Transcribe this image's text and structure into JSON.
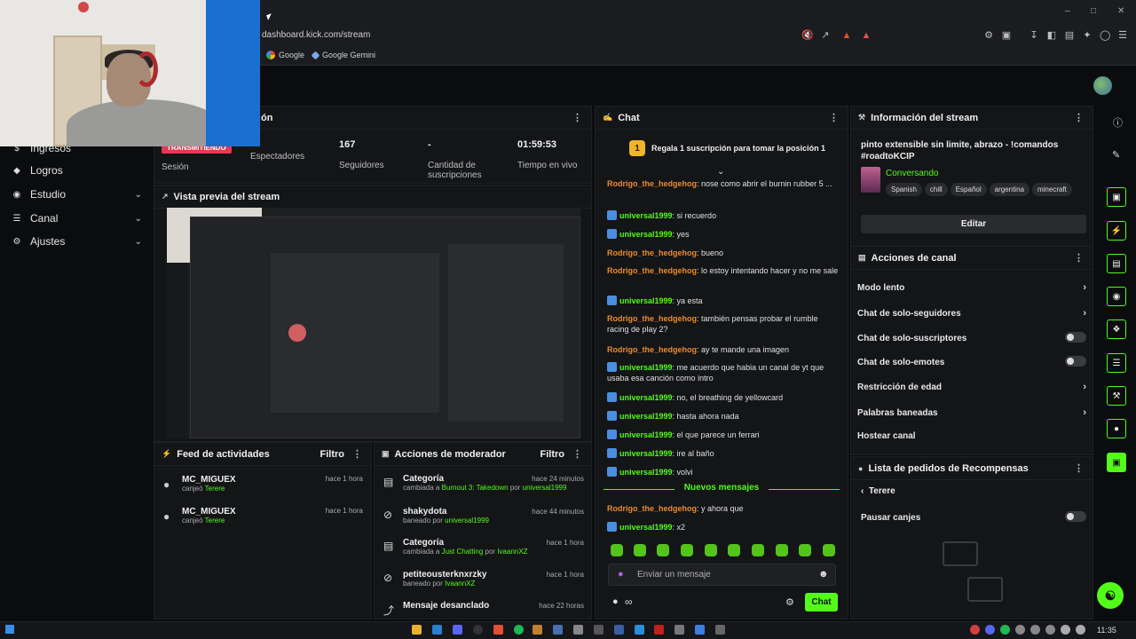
{
  "browser": {
    "url": "dashboard.kick.com/stream",
    "bookmarks": [
      "Google",
      "Google Gemini"
    ]
  },
  "sidebar": {
    "items": [
      {
        "label": "Ingresos",
        "icon": "dollar-icon",
        "chevron": false
      },
      {
        "label": "Logros",
        "icon": "trophy-icon",
        "chevron": false
      },
      {
        "label": "Estudio",
        "icon": "studio-icon",
        "chevron": true
      },
      {
        "label": "Canal",
        "icon": "channel-icon",
        "chevron": true
      },
      {
        "label": "Ajustes",
        "icon": "gear-icon",
        "chevron": true
      }
    ]
  },
  "session": {
    "title_fragment": "ón",
    "live_badge": "TRANSMITIENDO",
    "stats": [
      {
        "value": "",
        "label": "Sesión"
      },
      {
        "value": "",
        "label": "Espectadores"
      },
      {
        "value": "167",
        "label": "Seguidores"
      },
      {
        "value": "-",
        "label": "Cantidad de suscripciones"
      },
      {
        "value": "01:59:53",
        "label": "Tiempo en vivo"
      }
    ]
  },
  "preview": {
    "title": "Vista previa del stream"
  },
  "activity_feed": {
    "title": "Feed de actividades",
    "filter": "Filtro",
    "items": [
      {
        "user": "MC_MIGUEX",
        "action": "canjeó",
        "reward": "Terere",
        "time": "hace 1 hora"
      },
      {
        "user": "MC_MIGUEX",
        "action": "canjeó",
        "reward": "Terere",
        "time": "hace 1 hora"
      }
    ]
  },
  "mod_actions": {
    "title": "Acciones de moderador",
    "filter": "Filtro",
    "items": [
      {
        "title": "Categoría",
        "pre": "cambiada a",
        "target": "Burnout 3: Takedown",
        "mid": "por",
        "by": "universal1999",
        "time": "hace 24 minutos",
        "icon": "category-icon"
      },
      {
        "title": "shakydota",
        "pre": "baneado por",
        "target": "",
        "mid": "",
        "by": "universal1999",
        "time": "hace 44 minutos",
        "icon": "ban-icon"
      },
      {
        "title": "Categoría",
        "pre": "cambiada a",
        "target": "Just Chatting",
        "mid": "por",
        "by": "IvaannXZ",
        "time": "hace 1 hora",
        "icon": "category-icon"
      },
      {
        "title": "petiteousterknxrzky",
        "pre": "baneado por",
        "target": "",
        "mid": "",
        "by": "IvaannXZ",
        "time": "hace 1 hora",
        "icon": "ban-icon"
      },
      {
        "title": "Mensaje desanclado",
        "pre": "",
        "target": "",
        "mid": "",
        "by": "",
        "time": "hace 22 horas",
        "icon": "unpin-icon"
      }
    ]
  },
  "chat": {
    "title": "Chat",
    "gift_rank": "1",
    "gift_banner": "Regala 1 suscripción para tomar la posición 1",
    "messages": [
      {
        "user": "Rodrigo_the_hedgehog",
        "text": ": nose como abrir el burnin rubber 5 ...",
        "badge": false
      },
      {
        "user": "universal1999",
        "text": ": si recuerdo",
        "badge": true
      },
      {
        "user": "universal1999",
        "text": ": yes",
        "badge": true
      },
      {
        "user": "Rodrigo_the_hedgehog",
        "text": ": bueno",
        "badge": false
      },
      {
        "user": "Rodrigo_the_hedgehog",
        "text": ": lo estoy intentando hacer y no me sale",
        "badge": false
      },
      {
        "user": "universal1999",
        "text": ": ya esta",
        "badge": true
      },
      {
        "user": "Rodrigo_the_hedgehog",
        "text": ": también pensas probar el rumble racing de play 2?",
        "badge": false
      },
      {
        "user": "Rodrigo_the_hedgehog",
        "text": ": ay te mande una imagen",
        "badge": false
      },
      {
        "user": "universal1999",
        "text": ": me acuerdo que habia un canal de yt que usaba esa canción como intro",
        "badge": true
      },
      {
        "user": "universal1999",
        "text": ": no, el breathing de yellowcard",
        "badge": true
      },
      {
        "user": "universal1999",
        "text": ": hasta ahora nada",
        "badge": true
      },
      {
        "user": "universal1999",
        "text": ": el que parece un ferrari",
        "badge": true
      },
      {
        "user": "universal1999",
        "text": ": ire al baño",
        "badge": true
      },
      {
        "user": "universal1999",
        "text": ": volvi",
        "badge": true
      }
    ],
    "new_messages_label": "Nuevos mensajes",
    "new_messages": [
      {
        "user": "Rodrigo_the_hedgehog",
        "text": ": y ahora que",
        "badge": false
      },
      {
        "user": "universal1999",
        "text": ": x2",
        "badge": true
      }
    ],
    "input_placeholder": "Enviar un mensaje",
    "send_label": "Chat"
  },
  "stream_info": {
    "title": "Información del stream",
    "stream_title": "pinto extensible sin limite, abrazo - !comandos #roadtoKCIP",
    "category": "Conversando",
    "tags": [
      "Spanish",
      "chill",
      "Español",
      "argentina",
      "minecraft"
    ],
    "edit_label": "Editar"
  },
  "channel_actions": {
    "title": "Acciones de canal",
    "items": [
      {
        "label": "Modo lento",
        "control": "chevron"
      },
      {
        "label": "Chat de solo-seguidores",
        "control": "chevron"
      },
      {
        "label": "Chat de solo-suscriptores",
        "control": "toggle"
      },
      {
        "label": "Chat de solo-emotes",
        "control": "toggle"
      },
      {
        "label": "Restricción de edad",
        "control": "chevron"
      },
      {
        "label": "Palabras baneadas",
        "control": "chevron"
      },
      {
        "label": "Hostear canal",
        "control": "none"
      }
    ]
  },
  "rewards": {
    "title": "Lista de pedidos de Recompensas",
    "back_label": "Terere",
    "pause_label": "Pausar canjes"
  },
  "taskbar": {
    "clock": "11:35"
  },
  "colors": {
    "accent": "#53fc18",
    "live": "#e03a55",
    "user_orange": "#e98b2c"
  }
}
